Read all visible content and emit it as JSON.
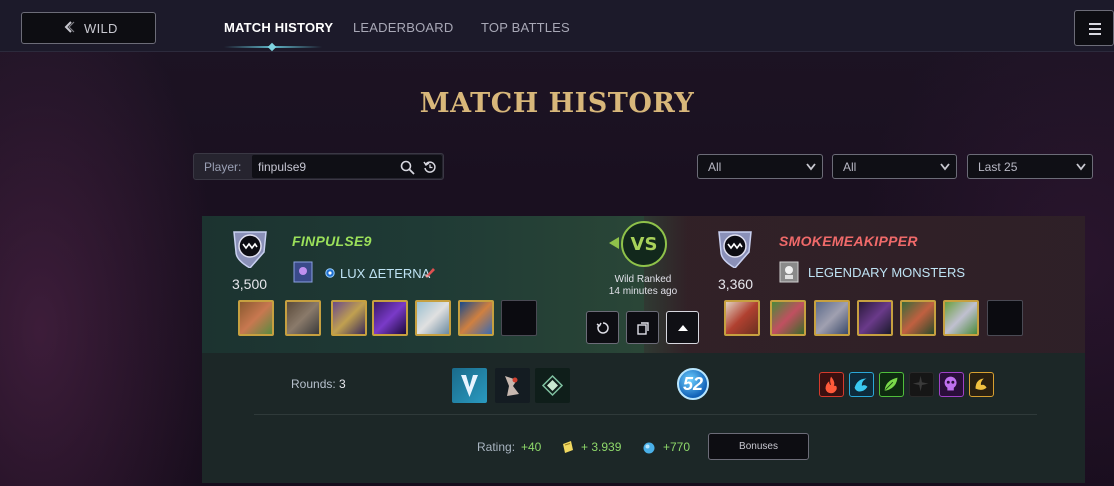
{
  "nav": {
    "back_label": "WILD",
    "tabs": [
      {
        "label": "MATCH HISTORY",
        "active": true
      },
      {
        "label": "LEADERBOARD",
        "active": false
      },
      {
        "label": "TOP BATTLES",
        "active": false
      }
    ]
  },
  "page_title": "MATCH HISTORY",
  "filters": {
    "player_label": "Player:",
    "player_value": "finpulse9",
    "selects": [
      "All",
      "All",
      "Last 25"
    ]
  },
  "battle": {
    "player1": {
      "name": "FINPULSE9",
      "rating": "3,500",
      "guild": "LUX ΔETERNA",
      "name_color": "#9be05a"
    },
    "player2": {
      "name": "SMOKEMEAKIPPER",
      "rating": "3,360",
      "guild": "LEGENDARY MONSTERS",
      "name_color": "#f06a6a"
    },
    "vs_label": "VS",
    "match_type": "Wild Ranked",
    "match_time": "14 minutes ago",
    "rounds_label": "Rounds:",
    "rounds_value": "3",
    "mana_cap": "52",
    "rating_label": "Rating:",
    "rating_change": "+40",
    "dec_change": "+ 3.939",
    "sps_change": "+770",
    "bonuses_label": "Bonuses",
    "colors": {
      "fire": "#d53a2c",
      "water": "#2aa7d8",
      "earth": "#4fbf3a",
      "life": "#e0b03a",
      "death": "#a040c8",
      "dragon": "#d8a030"
    }
  }
}
